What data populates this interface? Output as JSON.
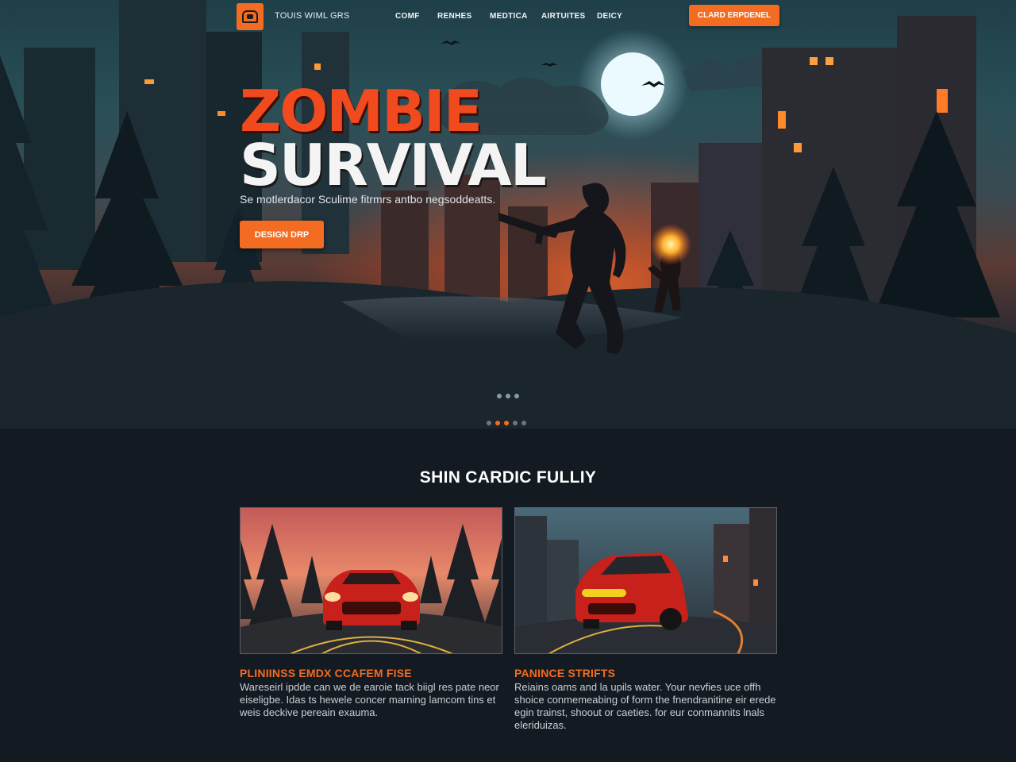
{
  "nav": {
    "brand": "TOUIS WIML GRS",
    "links": [
      "COMF",
      "RENHES",
      "MEDTICA",
      "AIRTUITES",
      "DEICY"
    ],
    "cta": "CLARD ERPDENEL"
  },
  "hero": {
    "title_line1": "ZOMBIE",
    "title_line2": "SURVIVAL",
    "tagline": "Se motlerdacor Sculime fitrmrs antbo negsoddeatts.",
    "button": "DESIGN DRP",
    "dots_upper": 3,
    "dots_lower": 5,
    "dots_lower_active": [
      1,
      2
    ]
  },
  "features": {
    "heading": "SHIN CARDIC FULLIY",
    "cards": [
      {
        "title": "PLINIINSS EMDX CCAFEM FISE",
        "text": "Wareseirl ipdde can we de earoie tack biigl res pate neor eiseligbe. Idas ts hewele concer marning lamcom tins et weis deckive pereain exauma."
      },
      {
        "title": "PANINCE STRIFTS",
        "text": "Reiains oams and la upils water. Your nevfies uce offh shoice conmemeabing of form the fnendranitine eir erede egin trainst, shoout or caeties. for eur conmannits lnals eleriduizas."
      }
    ]
  },
  "colors": {
    "accent": "#f36c21",
    "title_red": "#f04a1e",
    "background": "#131a22"
  }
}
